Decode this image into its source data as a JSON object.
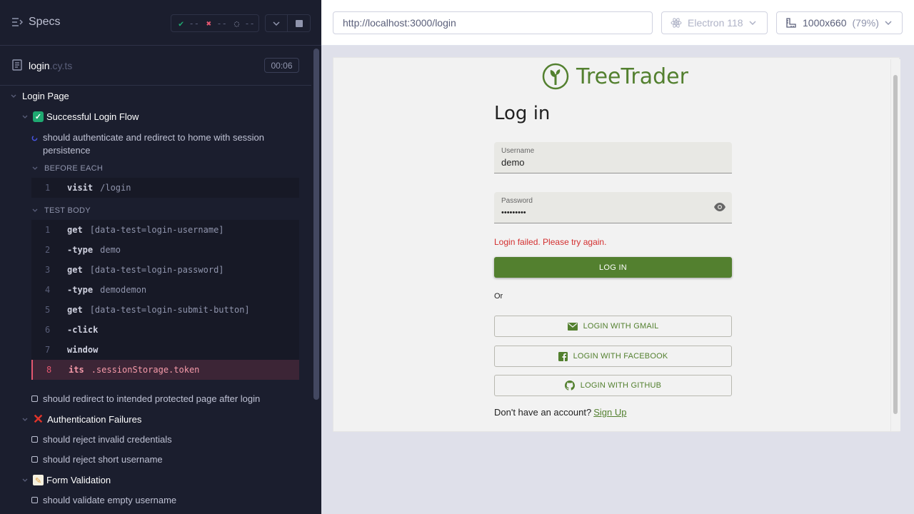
{
  "runner": {
    "title": "Specs",
    "stats": {
      "passed": "--",
      "failed": "--",
      "pending": "--"
    },
    "file": {
      "name": "login",
      "ext": ".cy.ts",
      "timer": "00:06"
    },
    "tree": {
      "root_suite": "Login Page",
      "suite1": {
        "label": "Successful Login Flow"
      },
      "test1": {
        "line1": "should authenticate and redirect to home with session",
        "line2": "persistence"
      },
      "before_each_label": "BEFORE EACH",
      "before_each_cmds": [
        {
          "num": "1",
          "name": "visit",
          "arg": "/login"
        }
      ],
      "test_body_label": "TEST BODY",
      "test_body_cmds": [
        {
          "num": "1",
          "name": "get",
          "arg": "[data-test=login-username]"
        },
        {
          "num": "2",
          "name": "-type",
          "arg": "demo"
        },
        {
          "num": "3",
          "name": "get",
          "arg": "[data-test=login-password]"
        },
        {
          "num": "4",
          "name": "-type",
          "arg": "demodemon"
        },
        {
          "num": "5",
          "name": "get",
          "arg": "[data-test=login-submit-button]"
        },
        {
          "num": "6",
          "name": "-click",
          "arg": ""
        },
        {
          "num": "7",
          "name": "window",
          "arg": ""
        },
        {
          "num": "8",
          "name": "its",
          "arg": ".sessionStorage.token"
        }
      ],
      "test2": "should redirect to intended protected page after login",
      "suite2": {
        "label": "Authentication Failures"
      },
      "test3": "should reject invalid credentials",
      "test4": "should reject short username",
      "suite3": {
        "label": "Form Validation"
      },
      "test5": "should validate empty username"
    }
  },
  "browser_bar": {
    "url": "http://localhost:3000/login",
    "browser": "Electron 118",
    "viewport": "1000x660",
    "scale": "(79%)"
  },
  "app": {
    "brand": "TreeTrader",
    "heading": "Log in",
    "username_label": "Username",
    "username_value": "demo",
    "password_label": "Password",
    "password_value": "•••••••••",
    "error": "Login failed. Please try again.",
    "login_button": "LOG IN",
    "or": "Or",
    "gmail_button": "LOGIN WITH GMAIL",
    "facebook_button": "LOGIN WITH FACEBOOK",
    "github_button": "LOGIN WITH GITHUB",
    "signup_prompt": "Don't have an account?",
    "signup_link": "Sign Up"
  },
  "colors": {
    "brand_green": "#53802f",
    "error_red": "#d32f2f",
    "runner_bg": "#1b1e2e",
    "fail_accent": "#e45770"
  }
}
